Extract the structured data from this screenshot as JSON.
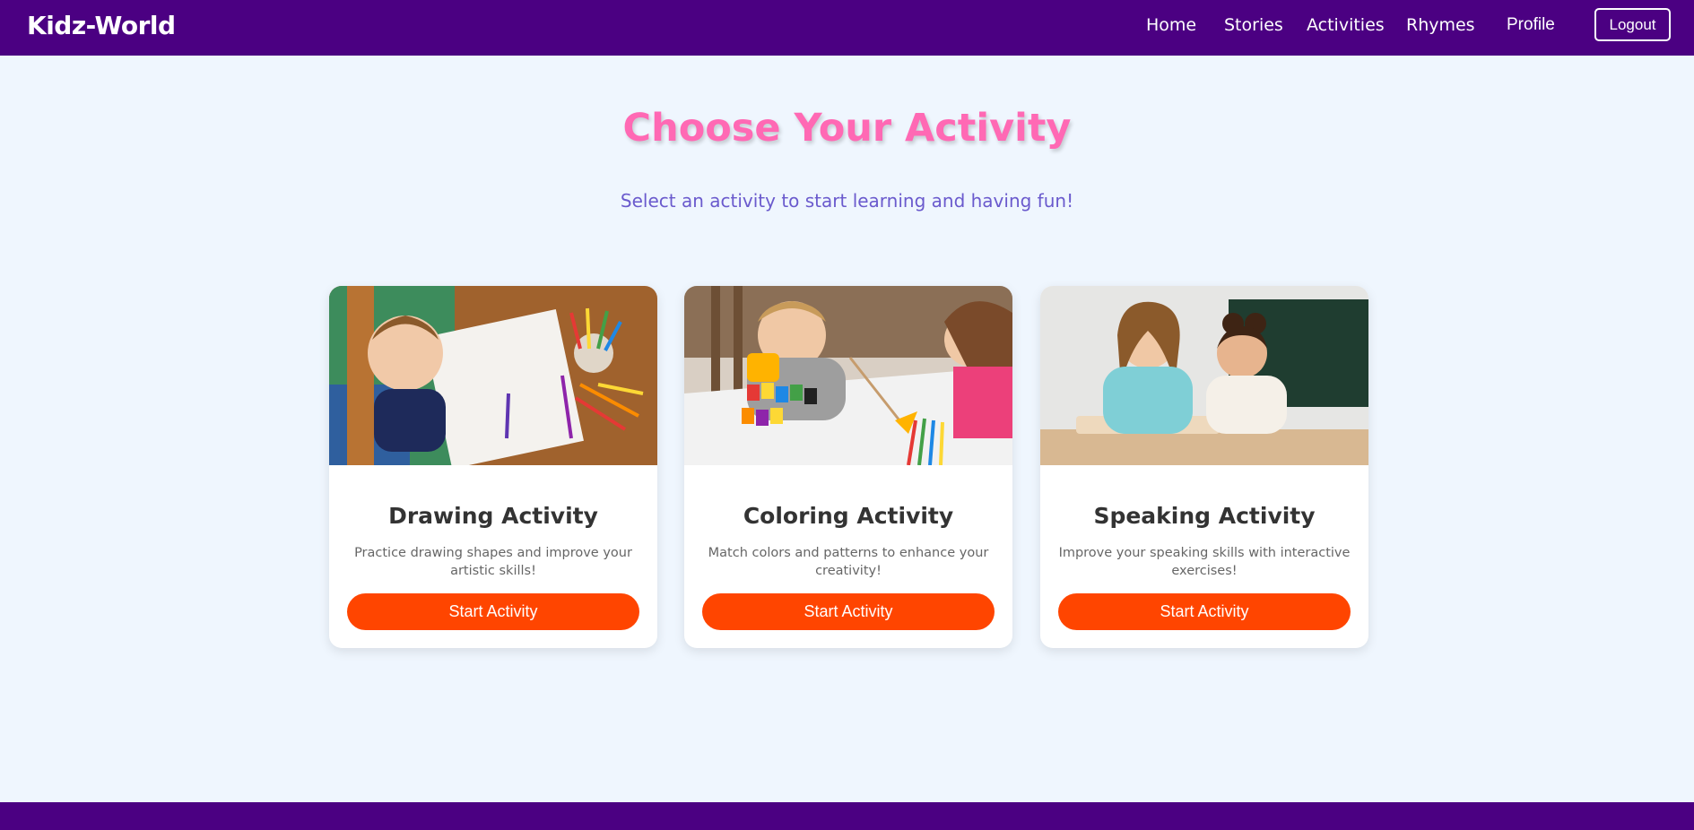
{
  "brand": "Kidz-World",
  "nav": {
    "home": "Home",
    "stories": "Stories",
    "activities": "Activities",
    "rhymes": "Rhymes",
    "profile": "Profile",
    "logout": "Logout"
  },
  "hero": {
    "title": "Choose Your Activity",
    "subtitle": "Select an activity to start learning and having fun!"
  },
  "cards": [
    {
      "title": "Drawing Activity",
      "description": "Practice drawing shapes and improve your artistic skills!",
      "button": "Start Activity",
      "image": "child-drawing-photo"
    },
    {
      "title": "Coloring Activity",
      "description": "Match colors and patterns to enhance your creativity!",
      "button": "Start Activity",
      "image": "children-painting-photo"
    },
    {
      "title": "Speaking Activity",
      "description": "Improve your speaking skills with interactive exercises!",
      "button": "Start Activity",
      "image": "mother-daughter-puzzle-photo"
    }
  ],
  "colors": {
    "nav_bg": "#4b0082",
    "title": "#ff69b4",
    "subtitle": "#6a5acd",
    "button": "#ff4500",
    "page_bg": "#eff6fe"
  }
}
